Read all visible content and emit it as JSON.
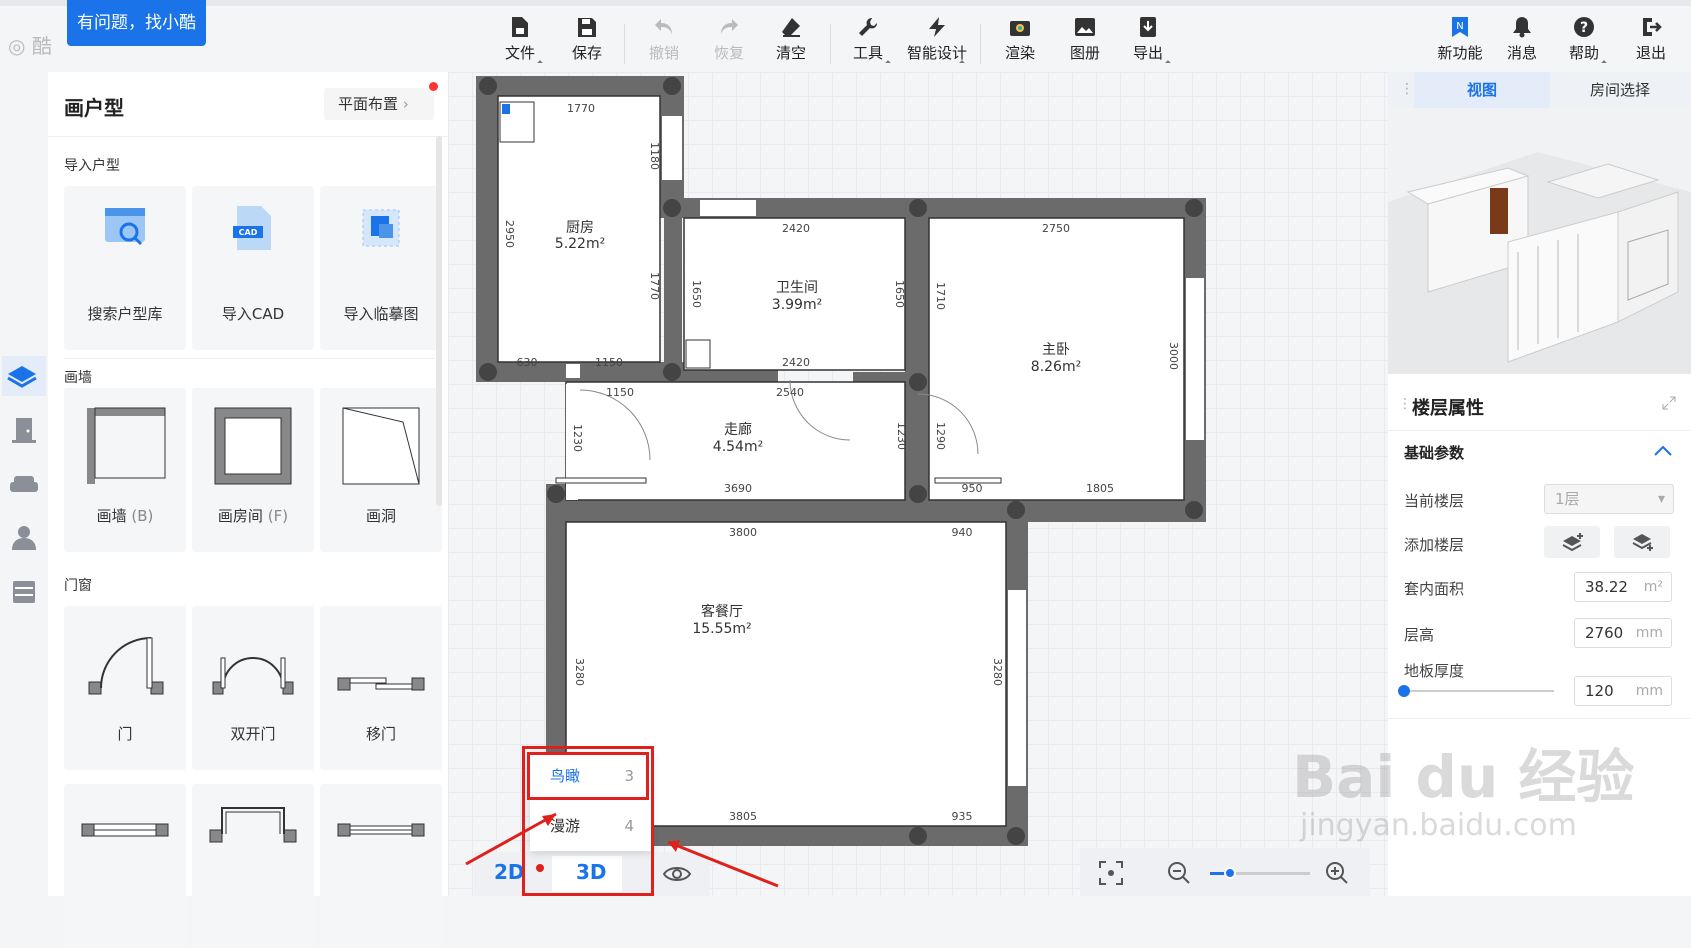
{
  "help_badge": "有问题，找小酷",
  "logo_text": "酷",
  "toolbar": {
    "file": "文件",
    "save": "保存",
    "undo": "撤销",
    "redo": "恢复",
    "clear": "清空",
    "tools": "工具",
    "smart_design": "智能设计",
    "render": "渲染",
    "album": "图册",
    "export": "导出",
    "new_feature": "新功能",
    "messages": "消息",
    "help": "帮助",
    "logout": "退出"
  },
  "panel": {
    "title": "画户型",
    "layout_button": "平面布置",
    "import_section": "导入户型",
    "import_items": [
      "搜索户型库",
      "导入CAD",
      "导入临摹图"
    ],
    "cad_badge": "CAD",
    "wall_section": "画墙",
    "wall_items": [
      {
        "label": "画墙",
        "key": "(B)"
      },
      {
        "label": "画房间",
        "key": "(F)"
      },
      {
        "label": "画洞",
        "key": ""
      }
    ],
    "door_section": "门窗",
    "door_items": [
      "门",
      "双开门",
      "移门"
    ]
  },
  "floorplan": {
    "rooms": [
      {
        "name": "厨房",
        "area": "5.22m²"
      },
      {
        "name": "卫生间",
        "area": "3.99m²"
      },
      {
        "name": "主卧",
        "area": "8.26m²"
      },
      {
        "name": "走廊",
        "area": "4.54m²"
      },
      {
        "name": "客餐厅",
        "area": "15.55m²"
      }
    ],
    "dims": [
      "1770",
      "1180",
      "2950",
      "1770",
      "630",
      "1150",
      "2420",
      "1650",
      "1650",
      "2420",
      "2750",
      "1710",
      "3000",
      "1150",
      "2540",
      "1230",
      "1230",
      "1290",
      "3690",
      "950",
      "1805",
      "3800",
      "940",
      "3280",
      "3280",
      "3805",
      "935"
    ]
  },
  "view_menu": {
    "items": [
      {
        "label": "鸟瞰",
        "shortcut": "3"
      },
      {
        "label": "漫游",
        "shortcut": "4"
      }
    ],
    "btn_2d": "2D",
    "btn_3d": "3D"
  },
  "right": {
    "tabs": [
      "视图",
      "房间选择"
    ],
    "section": "楼层属性",
    "subsection": "基础参数",
    "current_floor_label": "当前楼层",
    "current_floor_value": "1层",
    "add_floor_label": "添加楼层",
    "area_label": "套内面积",
    "area_value": "38.22",
    "area_unit": "m²",
    "height_label": "层高",
    "height_value": "2760",
    "height_unit": "mm",
    "thickness_label": "地板厚度",
    "thickness_value": "120",
    "thickness_unit": "mm",
    "slider_level": 0
  },
  "watermark": {
    "brand": "Bai du 经验",
    "url": "jingyan.baidu.com"
  },
  "colors": {
    "accent": "#1a73e8",
    "annotation": "#e0201c",
    "wall": "#6b6b6b"
  }
}
